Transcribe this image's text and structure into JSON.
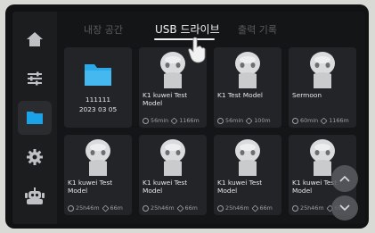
{
  "sidebar": {
    "items": [
      {
        "icon": "home-icon",
        "active": false
      },
      {
        "icon": "sliders-icon",
        "active": false
      },
      {
        "icon": "folder-icon",
        "active": true
      },
      {
        "icon": "gear-icon",
        "active": false
      },
      {
        "icon": "robot-icon",
        "active": false
      }
    ]
  },
  "tabs": [
    {
      "label": "내장 공간",
      "active": false
    },
    {
      "label": "USB 드라이브",
      "active": true
    },
    {
      "label": "출력 기록",
      "active": false
    }
  ],
  "folder": {
    "name": "111111",
    "date": "2023 03 05"
  },
  "files": [
    {
      "name": "K1 kuwei Test Model",
      "time": "56min",
      "filament": "1166m"
    },
    {
      "name": "K1 Test Model",
      "time": "56min",
      "filament": "100m"
    },
    {
      "name": "Sermoon",
      "time": "60min",
      "filament": "1166m"
    },
    {
      "name": "K1 kuwei Test Model",
      "time": "25h46m",
      "filament": "66m"
    },
    {
      "name": "K1 kuwei Test Model",
      "time": "25h46m",
      "filament": "66m"
    },
    {
      "name": "K1 kuwei Test Model",
      "time": "25h46m",
      "filament": "66m"
    },
    {
      "name": "K1 kuwei Test Model",
      "time": "25h46m",
      "filament": "66m"
    }
  ],
  "colors": {
    "accent": "#1aa3e6",
    "background": "#141516",
    "card": "#232428"
  }
}
